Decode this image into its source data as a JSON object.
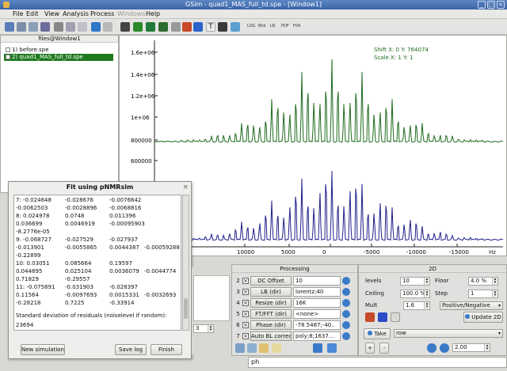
{
  "window": {
    "title": "GSim - quad1_MAS_full_td.spe - [Window1]"
  },
  "menu": {
    "items": [
      "File",
      "Edit",
      "View",
      "Analysis",
      "Process",
      "Windows",
      "Help"
    ]
  },
  "toolbar": {
    "text_buttons": [
      "LOG",
      "Bkb",
      "LB",
      "PDF",
      "F04"
    ]
  },
  "files": {
    "title": "files@Window1",
    "items": [
      {
        "label": "1)  before.spe",
        "selected": false
      },
      {
        "label": "2)  quad1_MAS_full_td.spe",
        "selected": true
      }
    ]
  },
  "plot": {
    "shift_label": "Shift X: 0   Y: 764074",
    "scale_label": "Scale X: 1   Y: 1",
    "y_ticks": [
      "1.6e+06",
      "1.4e+06",
      "1.2e+06",
      "1e+06",
      "800000",
      "800000",
      "600000"
    ],
    "x_ticks": [
      "5000",
      "10000",
      "5000",
      "0",
      "-5000",
      "-10000",
      "-15000"
    ],
    "x_unit": "Hz",
    "series_colors": {
      "upper": "#1f6b1f",
      "lower": "#20208a"
    }
  },
  "fit": {
    "title": "Fit using pNMRsim",
    "log_rows": [
      [
        "7: -0.024648",
        "-0.028676",
        "-0.0076642"
      ],
      [
        "-0.0062503",
        "-0.0028896",
        "-0.0068816",
        ""
      ],
      [
        "8: 0.024978",
        "0.0748",
        "0.011396"
      ],
      [
        "0.036699",
        "0.0046919",
        "-0.00095903",
        ""
      ],
      [
        "-8.2776e-05",
        "",
        ""
      ],
      [
        "9: -0.068727",
        "-0.027529",
        "-0.027937"
      ],
      [
        "-0.013901",
        "-0.0055865",
        "0.0044387",
        "-0.00059288"
      ],
      [
        "-0.22899",
        "",
        ""
      ],
      [
        "10: 0.03051",
        "0.085664",
        "0.19597"
      ],
      [
        "0.044895",
        "0.025104",
        "0.0036079",
        "-0.0044774"
      ],
      [
        "0.71829",
        "-0.29557",
        ""
      ],
      [
        "11: -0.075891",
        "-0.031903",
        "-0.028397"
      ],
      [
        "0.11564",
        "-0.0097693",
        "0.0015331",
        "-0.0032693"
      ],
      [
        "-0.28218",
        "0.7225",
        "-0.33914"
      ]
    ],
    "std_text": "Standard deviation of residuals (noiselevel if random):",
    "std_value": "23694",
    "buttons": {
      "new_sim": "New simulation",
      "save_log": "Save log",
      "finish": "Finish"
    }
  },
  "lowerleft": {
    "value": "3"
  },
  "processing": {
    "title": "Processing",
    "rows": [
      {
        "num": "2",
        "label": "DC Offset",
        "value": "10"
      },
      {
        "num": "3",
        "label": "LB (dir)",
        "value": "lorentz;40"
      },
      {
        "num": "4",
        "label": "Resize (dir)",
        "value": "16K"
      },
      {
        "num": "5",
        "label": "FT/FFT (dir)",
        "value": "<none>"
      },
      {
        "num": "6",
        "label": "Phase (dir)",
        "value": "-78.5487;-40.."
      },
      {
        "num": "7",
        "label": "Auto BL correction",
        "value": "poly;8;1637..."
      }
    ]
  },
  "twod": {
    "title": "2D",
    "levels_label": "levels",
    "levels_value": "10",
    "floor_label": "Floor",
    "floor_value": "4.0 %",
    "ceiling_label": "Ceiling",
    "ceiling_value": "100.0 %",
    "step_label": "Step",
    "step_value": "1",
    "mult_label": "Mult",
    "mult_value": "1.6",
    "mode": "Positive/Negative",
    "update_label": "Update 2D",
    "take_label": "Take",
    "take_target": "row",
    "plus": "+",
    "minus": "-",
    "scale_value": "2.00"
  },
  "command": {
    "text": "ph"
  }
}
